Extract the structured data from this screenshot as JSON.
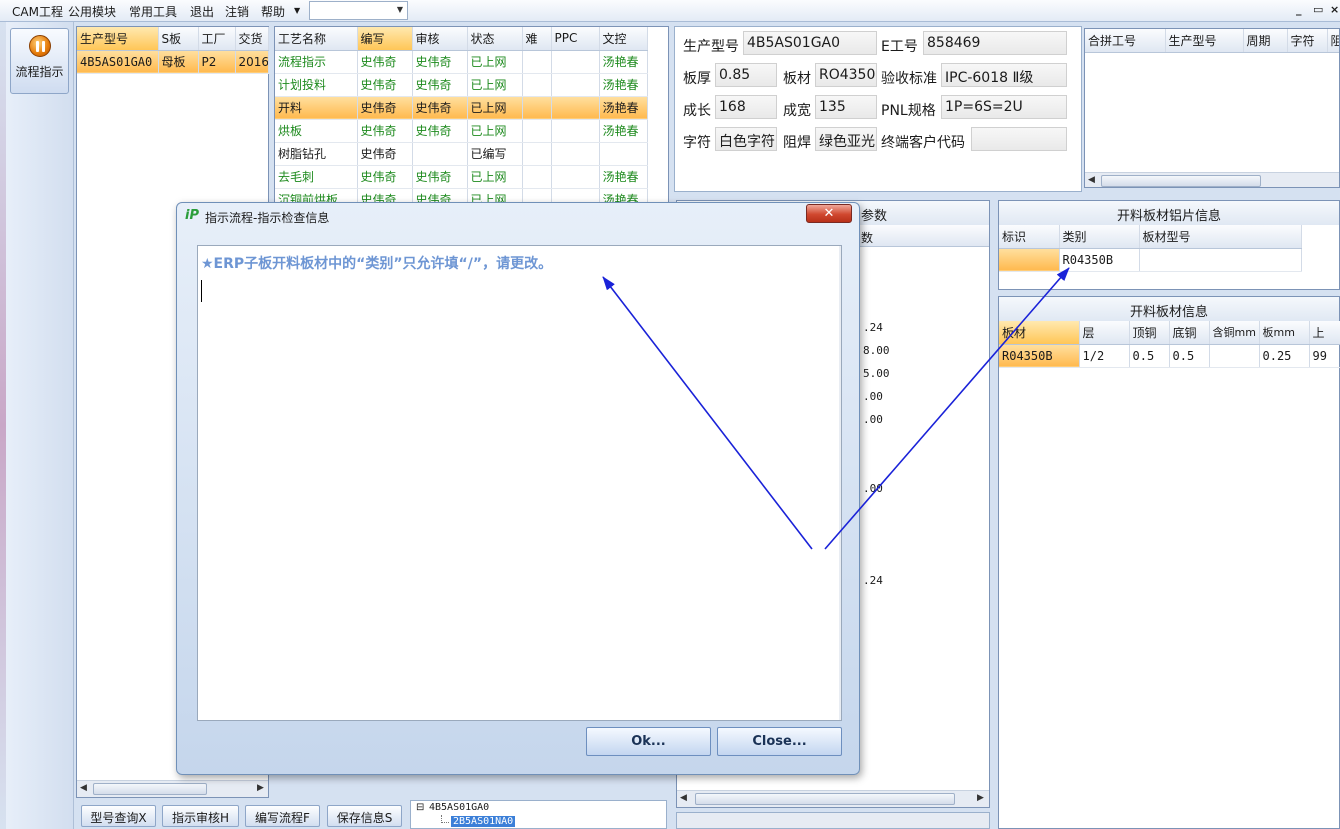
{
  "menu": {
    "items": [
      "CAM工程",
      "公用模块",
      "常用工具",
      "退出",
      "注销",
      "帮助"
    ],
    "combo_value": "",
    "window_buttons": [
      "_",
      "▭",
      "×"
    ]
  },
  "sidebar": {
    "flow_button_label": "流程指示"
  },
  "order_table": {
    "headers": [
      "生产型号",
      "S板",
      "工厂",
      "交货"
    ],
    "rows": [
      [
        "4B5AS01GA0",
        "母板",
        "P2",
        "2016"
      ]
    ]
  },
  "process_table": {
    "headers": [
      "工艺名称",
      "编写",
      "审核",
      "状态",
      "难",
      "PPC",
      "文控"
    ],
    "rows": [
      [
        "流程指示",
        "史伟奇",
        "史伟奇",
        "已上网",
        "",
        "",
        "汤艳春"
      ],
      [
        "计划投料",
        "史伟奇",
        "史伟奇",
        "已上网",
        "",
        "",
        "汤艳春"
      ],
      [
        "开料",
        "史伟奇",
        "史伟奇",
        "已上网",
        "",
        "",
        "汤艳春"
      ],
      [
        "烘板",
        "史伟奇",
        "史伟奇",
        "已上网",
        "",
        "",
        "汤艳春"
      ],
      [
        "树脂钻孔",
        "史伟奇",
        "",
        "已编写",
        "",
        "",
        ""
      ],
      [
        "去毛刺",
        "史伟奇",
        "史伟奇",
        "已上网",
        "",
        "",
        "汤艳春"
      ],
      [
        "沉铜前烘板",
        "史伟奇",
        "史伟奇",
        "已上网",
        "",
        "",
        "汤艳春"
      ]
    ]
  },
  "info": {
    "model_label": "生产型号",
    "model_value": "4B5AS01GA0",
    "e_label": "E工号",
    "e_value": "858469",
    "thickness_label": "板厚",
    "thickness_value": "0.85",
    "material_label": "板材",
    "material_value": "RO4350B",
    "standard_label": "验收标准",
    "standard_value": "IPC-6018 Ⅱ级",
    "length_label": "成长",
    "length_value": "168",
    "width_label": "成宽",
    "width_value": "135",
    "pnl_label": "PNL规格",
    "pnl_value": "1P=6S=2U",
    "char_label": "字符",
    "char_value": "白色字符",
    "mask_label": "阻焊",
    "mask_value": "绿色亚光",
    "customer_label": "终端客户代码",
    "customer_value": ""
  },
  "merge_table": {
    "headers": [
      "合拼工号",
      "生产型号",
      "周期",
      "字符",
      "阻"
    ]
  },
  "param_panel": {
    "title": "参数",
    "header": "数",
    "values": [
      ".24",
      "8.00",
      "5.00",
      ".00",
      ".00",
      ".00",
      ".24"
    ]
  },
  "al_sheet": {
    "title": "开料板材铝片信息",
    "headers": [
      "标识",
      "类别",
      "板材型号"
    ],
    "rows": [
      [
        "",
        "R04350B",
        ""
      ]
    ]
  },
  "sheet_info": {
    "title": "开料板材信息",
    "headers": [
      "板材",
      "层",
      "顶铜",
      "底铜",
      "含铜mm",
      "板mm",
      "上"
    ],
    "rows": [
      [
        "R04350B",
        "1/2",
        "0.5",
        "0.5",
        "",
        "0.25",
        "99"
      ]
    ]
  },
  "bottom_buttons": [
    "型号查询X",
    "指示审核H",
    "编写流程F",
    "保存信息S"
  ],
  "tree": {
    "root": "4B5AS01GA0",
    "child": "2B5AS01NA0"
  },
  "dialog": {
    "logo": "iP",
    "title": "指示流程-指示检查信息",
    "close_glyph": "✕",
    "message": "★ERP子板开料板材中的“类别”只允许填“/”，请更改。",
    "ok_label": "Ok...",
    "close_label": "Close..."
  },
  "colors": {
    "accent_orange": "#ffb94e",
    "green_text": "#1d8a1d",
    "message_blue": "#6e96d4",
    "arrow_blue": "#1a22d8"
  }
}
